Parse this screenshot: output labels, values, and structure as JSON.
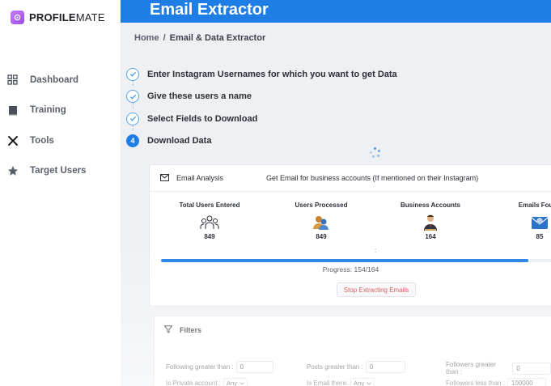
{
  "brand": {
    "name_bold": "PROFILE",
    "name_light": "MATE"
  },
  "sidebar": {
    "items": [
      {
        "label": "Dashboard",
        "icon": "grid-icon"
      },
      {
        "label": "Training",
        "icon": "book-icon"
      },
      {
        "label": "Tools",
        "icon": "tools-icon"
      },
      {
        "label": "Target Users",
        "icon": "star-icon"
      }
    ]
  },
  "header": {
    "title": "Email Extractor"
  },
  "breadcrumb": {
    "home": "Home",
    "separator": "/",
    "current": "Email & Data Extractor"
  },
  "steps": [
    {
      "label": "Enter Instagram Usernames for which you want to get Data",
      "status": "done"
    },
    {
      "label": "Give these users a name",
      "status": "done"
    },
    {
      "label": "Select Fields to Download",
      "status": "done"
    },
    {
      "number": "4",
      "label": "Download Data",
      "status": "active"
    }
  ],
  "analysis": {
    "title": "Email Analysis",
    "description": "Get Email for business accounts (If mentioned on their Instagram)",
    "stats": [
      {
        "label": "Total Users Entered",
        "value": "849",
        "icon": "users-group-icon"
      },
      {
        "label": "Users Processed",
        "value": "849",
        "icon": "users-processed-icon"
      },
      {
        "label": "Business Accounts",
        "value": "164",
        "icon": "business-person-icon"
      },
      {
        "label": "Emails Found",
        "value": "85",
        "icon": "email-envelope-icon"
      }
    ],
    "separator": ":",
    "progress": {
      "text": "Progress: 154/164",
      "fraction": 0.939
    },
    "stop_button": "Stop Extracting Emails"
  },
  "filters": {
    "title": "Filters",
    "row1": [
      {
        "label": "Following greater than :",
        "value": "0"
      },
      {
        "label": "Posts greater than :",
        "value": "0"
      },
      {
        "label": "Followers greater than :",
        "value": "0"
      }
    ],
    "row2": [
      {
        "label": "Is Private account :",
        "value": "Any"
      },
      {
        "label": "Is Email there:",
        "value": "Any"
      },
      {
        "label": "Followers less than :",
        "value": "100000"
      }
    ]
  },
  "colors": {
    "primary": "#1f7ee6",
    "danger": "#d13a3a",
    "brand": "#b064f0"
  }
}
